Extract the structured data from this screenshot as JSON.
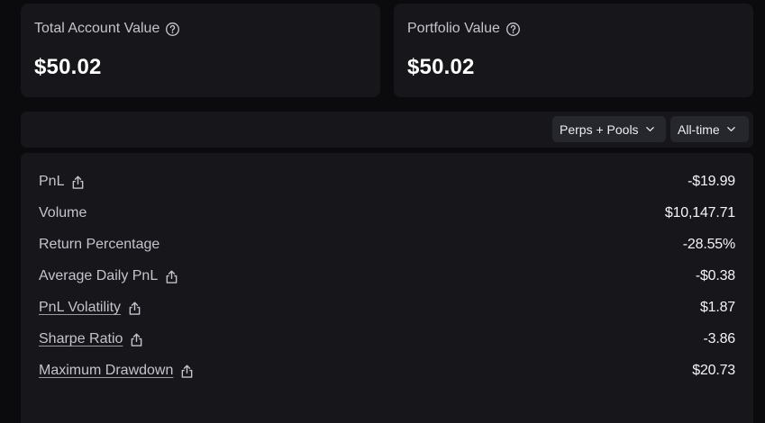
{
  "summary": {
    "total_account": {
      "label": "Total Account Value",
      "value": "$50.02"
    },
    "portfolio": {
      "label": "Portfolio Value",
      "value": "$50.02"
    }
  },
  "filters": {
    "mode": "Perps + Pools",
    "range": "All-time"
  },
  "stats": [
    {
      "label": "PnL",
      "value": "-$19.99",
      "link": false,
      "share": true
    },
    {
      "label": "Volume",
      "value": "$10,147.71",
      "link": false,
      "share": false
    },
    {
      "label": "Return Percentage",
      "value": "-28.55%",
      "link": false,
      "share": false
    },
    {
      "label": "Average Daily PnL",
      "value": "-$0.38",
      "link": false,
      "share": true
    },
    {
      "label": "PnL Volatility",
      "value": "$1.87",
      "link": true,
      "share": true
    },
    {
      "label": "Sharpe Ratio",
      "value": "-3.86",
      "link": true,
      "share": true
    },
    {
      "label": "Maximum Drawdown",
      "value": "$20.73",
      "link": true,
      "share": true
    }
  ],
  "icons": {
    "help": "help-circle-icon",
    "share": "share-icon",
    "chevron": "chevron-down-icon"
  }
}
